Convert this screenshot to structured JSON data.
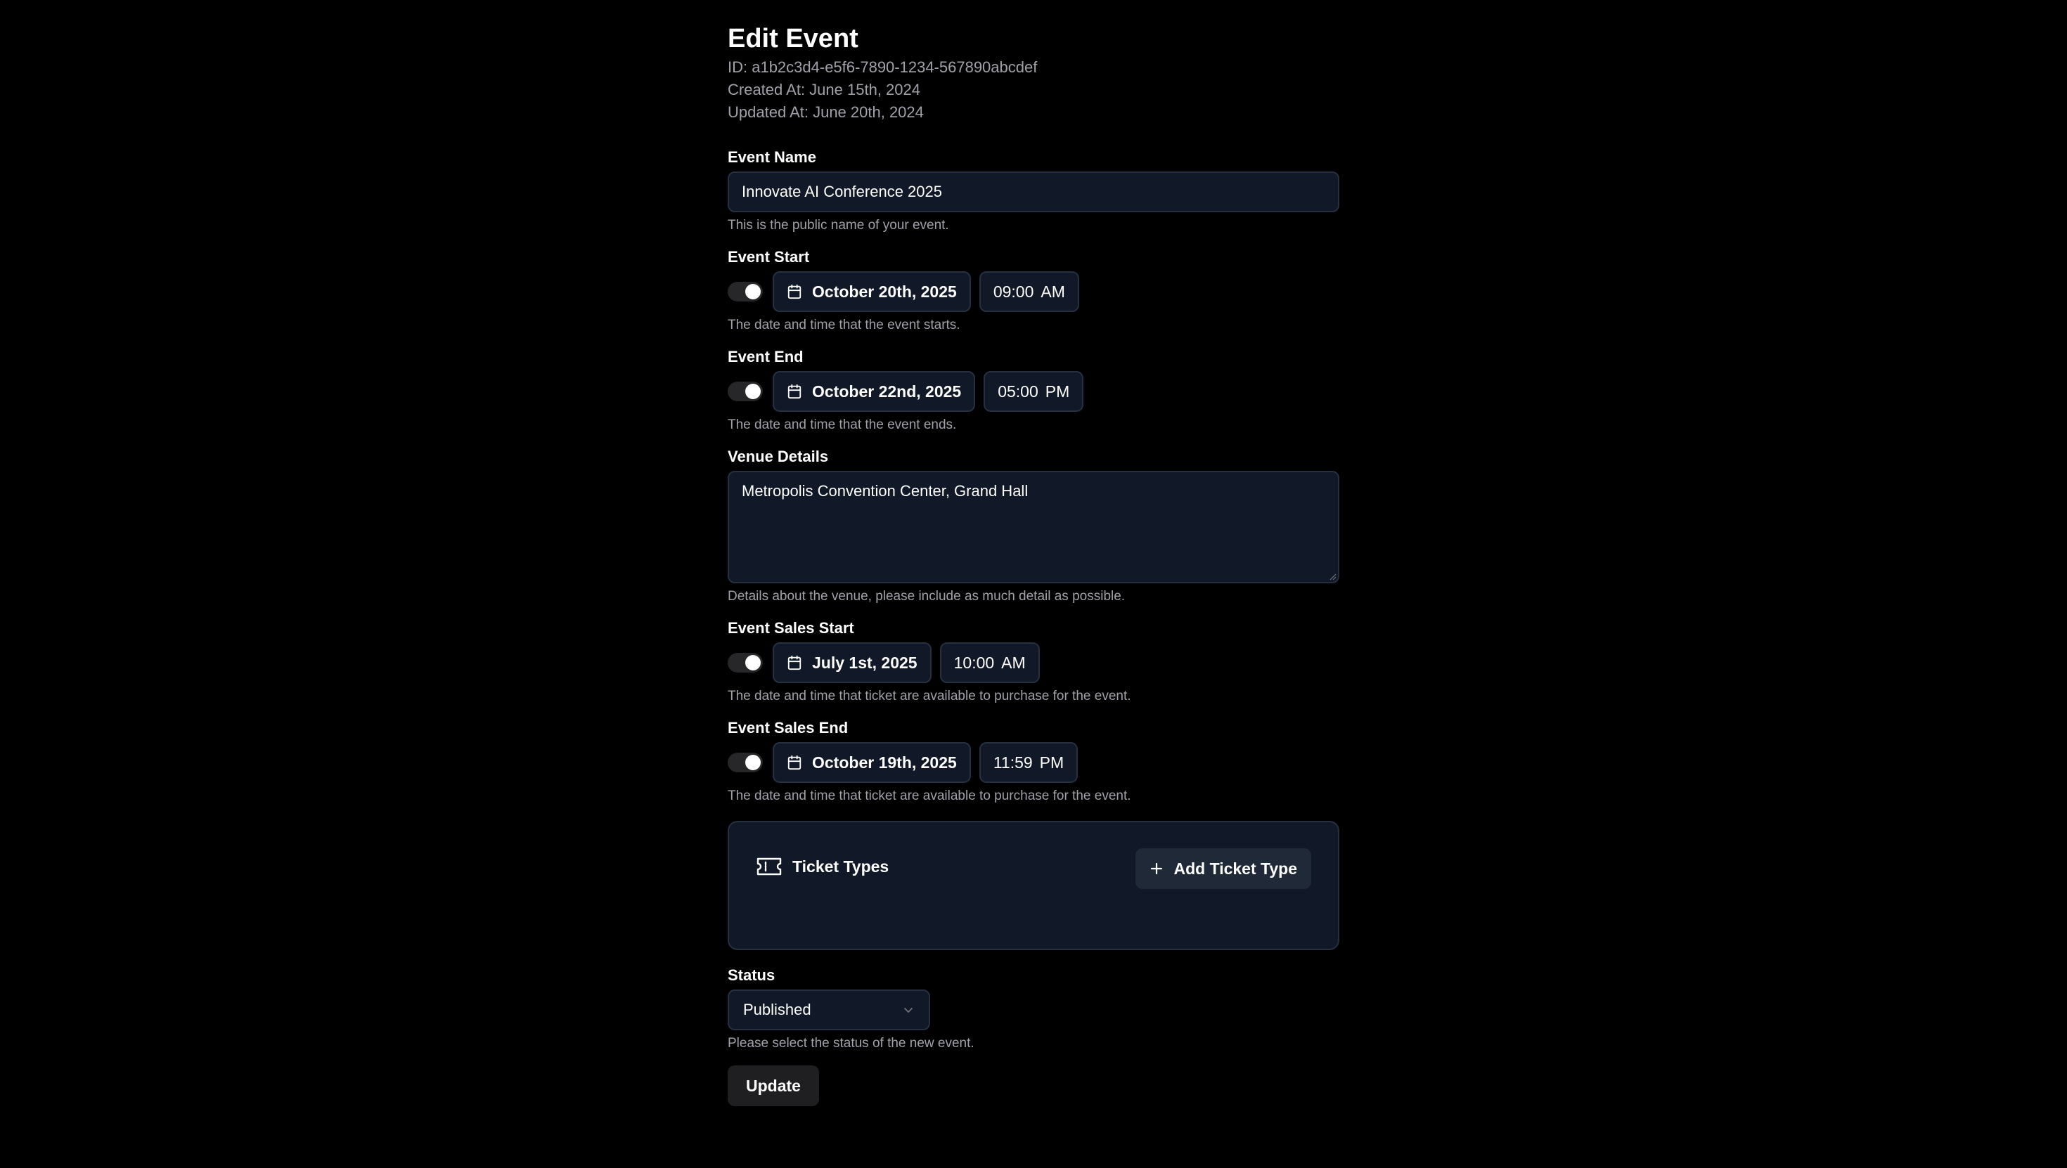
{
  "header": {
    "title": "Edit Event",
    "id_line": "ID: a1b2c3d4-e5f6-7890-1234-567890abcdef",
    "created_line": "Created At: June 15th, 2024",
    "updated_line": "Updated At: June 20th, 2024"
  },
  "event_name": {
    "label": "Event Name",
    "value": "Innovate AI Conference 2025",
    "hint": "This is the public name of your event."
  },
  "event_start": {
    "label": "Event Start",
    "toggle_on": true,
    "date": "October 20th, 2025",
    "time": "09:00",
    "ampm": "AM",
    "hint": "The date and time that the event starts."
  },
  "event_end": {
    "label": "Event End",
    "toggle_on": true,
    "date": "October 22nd, 2025",
    "time": "05:00",
    "ampm": "PM",
    "hint": "The date and time that the event ends."
  },
  "venue": {
    "label": "Venue Details",
    "value": "Metropolis Convention Center, Grand Hall",
    "hint": "Details about the venue, please include as much detail as possible."
  },
  "sales_start": {
    "label": "Event Sales Start",
    "toggle_on": true,
    "date": "July 1st, 2025",
    "time": "10:00",
    "ampm": "AM",
    "hint": "The date and time that ticket are available to purchase for the event."
  },
  "sales_end": {
    "label": "Event Sales End",
    "toggle_on": true,
    "date": "October 19th, 2025",
    "time": "11:59",
    "ampm": "PM",
    "hint": "The date and time that ticket are available to purchase for the event."
  },
  "ticket_types": {
    "title": "Ticket Types",
    "icon": "ticket-icon",
    "add_label": "Add Ticket Type",
    "add_icon": "plus-icon"
  },
  "status": {
    "label": "Status",
    "selected": "Published",
    "hint": "Please select the status of the new event."
  },
  "actions": {
    "update_label": "Update"
  },
  "colors": {
    "background": "#000000",
    "field_bg": "#111827",
    "field_border": "#27303f",
    "muted_text": "#a1a1aa"
  }
}
